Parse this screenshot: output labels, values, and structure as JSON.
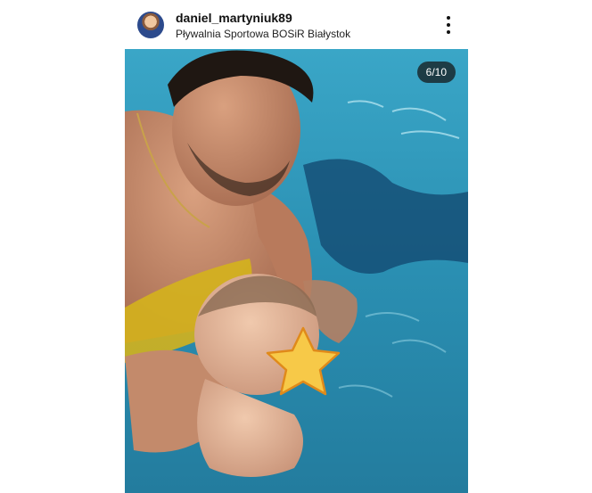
{
  "post": {
    "username": "daniel_martyniuk89",
    "location": "Pływalnia Sportowa BOSiR Białystok",
    "counter": "6/10"
  },
  "icons": {
    "avatar": "profile-avatar",
    "more": "vertical-ellipsis-icon",
    "face_cover": "star-icon"
  },
  "colors": {
    "water": "#2a93b5",
    "star_fill": "#f7c948",
    "star_stroke": "#e08a1a"
  }
}
